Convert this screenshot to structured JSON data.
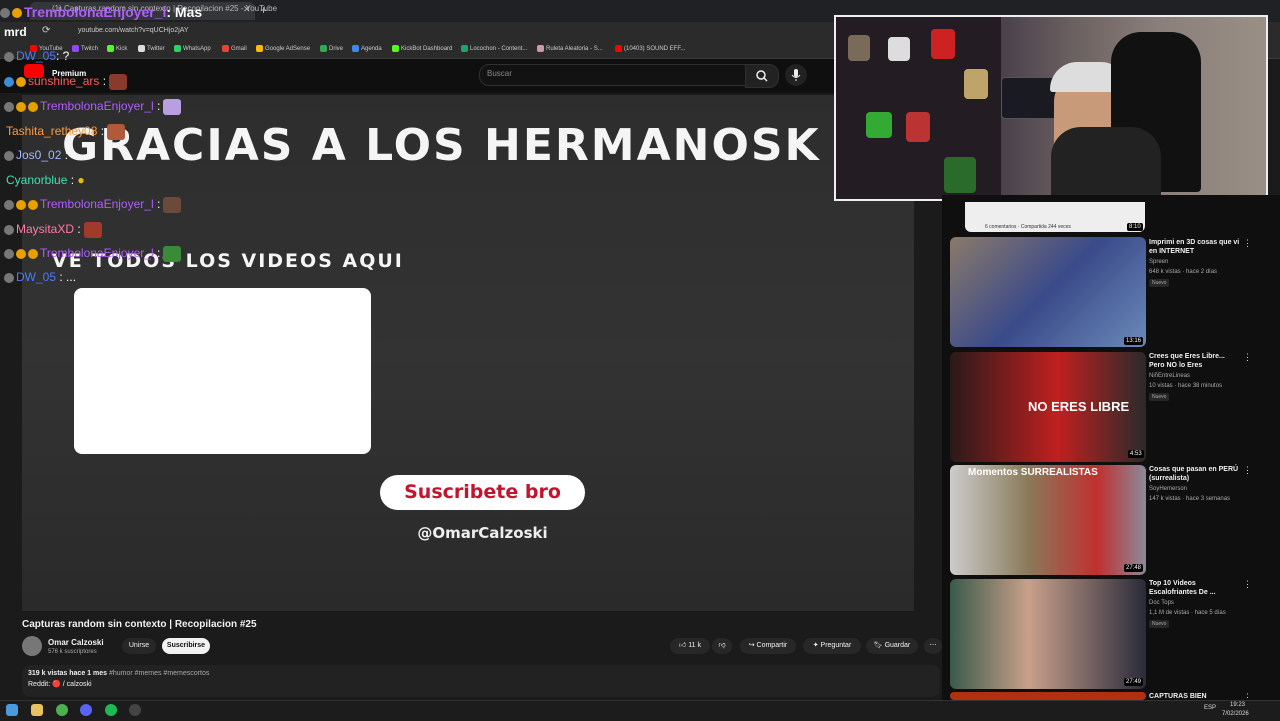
{
  "browser": {
    "tab_title": "(1) Capturas random sin contexto | Recopilacion #25 - YouTube",
    "url": "youtube.com/watch?v=qUCHjo2jAY",
    "bookmarks": [
      "YouTube",
      "Twitch",
      "Kick",
      "Twitter",
      "WhatsApp",
      "Gmail",
      "Google AdSense",
      "Drive",
      "Agenda",
      "KickBot Dashboard",
      "Locochon - Content...",
      "Ruleta Aleatoria - S...",
      "(10403) SOUND EFF..."
    ]
  },
  "youtube": {
    "logo_badge": "Premium",
    "search_placeholder": "Buscar",
    "video_overlay": {
      "headline": "GRACIAS A LOS HERMANOSK",
      "subline": "VE TODOS LOS VIDEOS AQUI",
      "subscribe_text": "Suscribete bro",
      "handle": "@OmarCalzoski"
    },
    "video_title": "Capturas random sin contexto | Recopilacion #25",
    "channel_name": "Omar Calzoski",
    "subscribers": "576 k suscriptores",
    "join_label": "Unirse",
    "subscribe_label": "Suscribirse",
    "likes": "11 k",
    "share_label": "Compartir",
    "ask_label": "Preguntar",
    "save_label": "Guardar",
    "desc_line1_stats": "319 k vistas  hace 1 mes",
    "desc_line1_tags": "#humor #memes #memescortos",
    "desc_line2": "Reddit: 🔴 / calzoski"
  },
  "chat": [
    {
      "user": "DW_05",
      "msg": ": ?",
      "color": "#4b7bff"
    },
    {
      "user": "sunshine_ars",
      "msg": ":",
      "color": "#ff5a5a"
    },
    {
      "user": "TrembolonaEnjoyer_l",
      "msg": ":",
      "color": "#b05cff"
    },
    {
      "user": "Tashita_rethey08",
      "msg": ":",
      "color": "#ff9a3c"
    },
    {
      "user": "Jos0_02",
      "msg": ":",
      "color": "#a0b8ff"
    },
    {
      "user": "Cyanorblue",
      "msg": ":",
      "color": "#3fe0b0"
    },
    {
      "user": "TrembolonaEnjoyer_l",
      "msg": ":",
      "color": "#b05cff"
    },
    {
      "user": "MaysitaXD",
      "msg": ":",
      "color": "#ff7aa8"
    },
    {
      "user": "TrembolonaEnjoyer_l",
      "msg": ":",
      "color": "#b05cff"
    },
    {
      "user": "DW_05",
      "msg": ": ...",
      "color": "#4b7bff"
    }
  ],
  "chat_header": {
    "user": "TrembolonaEnjoyer_l",
    "suffix": ": Mas",
    "prefix": "mrd"
  },
  "related": [
    {
      "title": "Imprimi en 3D cosas que vi en INTERNET",
      "channel": "Spreen",
      "meta": "648 k vistas · hace 2 días",
      "duration": "13:16",
      "badge": "Nuevo"
    },
    {
      "title": "Crees que Eres Libre... Pero NO lo Eres",
      "channel": "NiñEntreLineas",
      "meta": "10 vistas · hace 38 minutos",
      "duration": "4:53",
      "badge": "Nuevo",
      "thumb_text": "NO ERES LIBRE"
    },
    {
      "title": "Cosas que pasan en PERÚ (surrealista)",
      "channel": "SoyHemerson",
      "meta": "147 k vistas · hace 3 semanas",
      "duration": "27:48",
      "badge": "",
      "thumb_text": "Momentos SURREALISTAS"
    },
    {
      "title": "Top 10 Videos Escalofriantes De ...",
      "channel": "Doc Tops",
      "meta": "1,1 M de vistas · hace 5 días",
      "duration": "27:49",
      "badge": "Nuevo"
    },
    {
      "title": "CAPTURAS BIEN",
      "channel": "",
      "meta": "",
      "duration": "",
      "badge": ""
    }
  ],
  "sidebar_top_stats": "6 comentarios · Compartida 244 veces",
  "sidebar_top_duration": "8:10",
  "taskbar": {
    "lang": "ESP",
    "time": "19:23",
    "date": "7/02/2026"
  }
}
